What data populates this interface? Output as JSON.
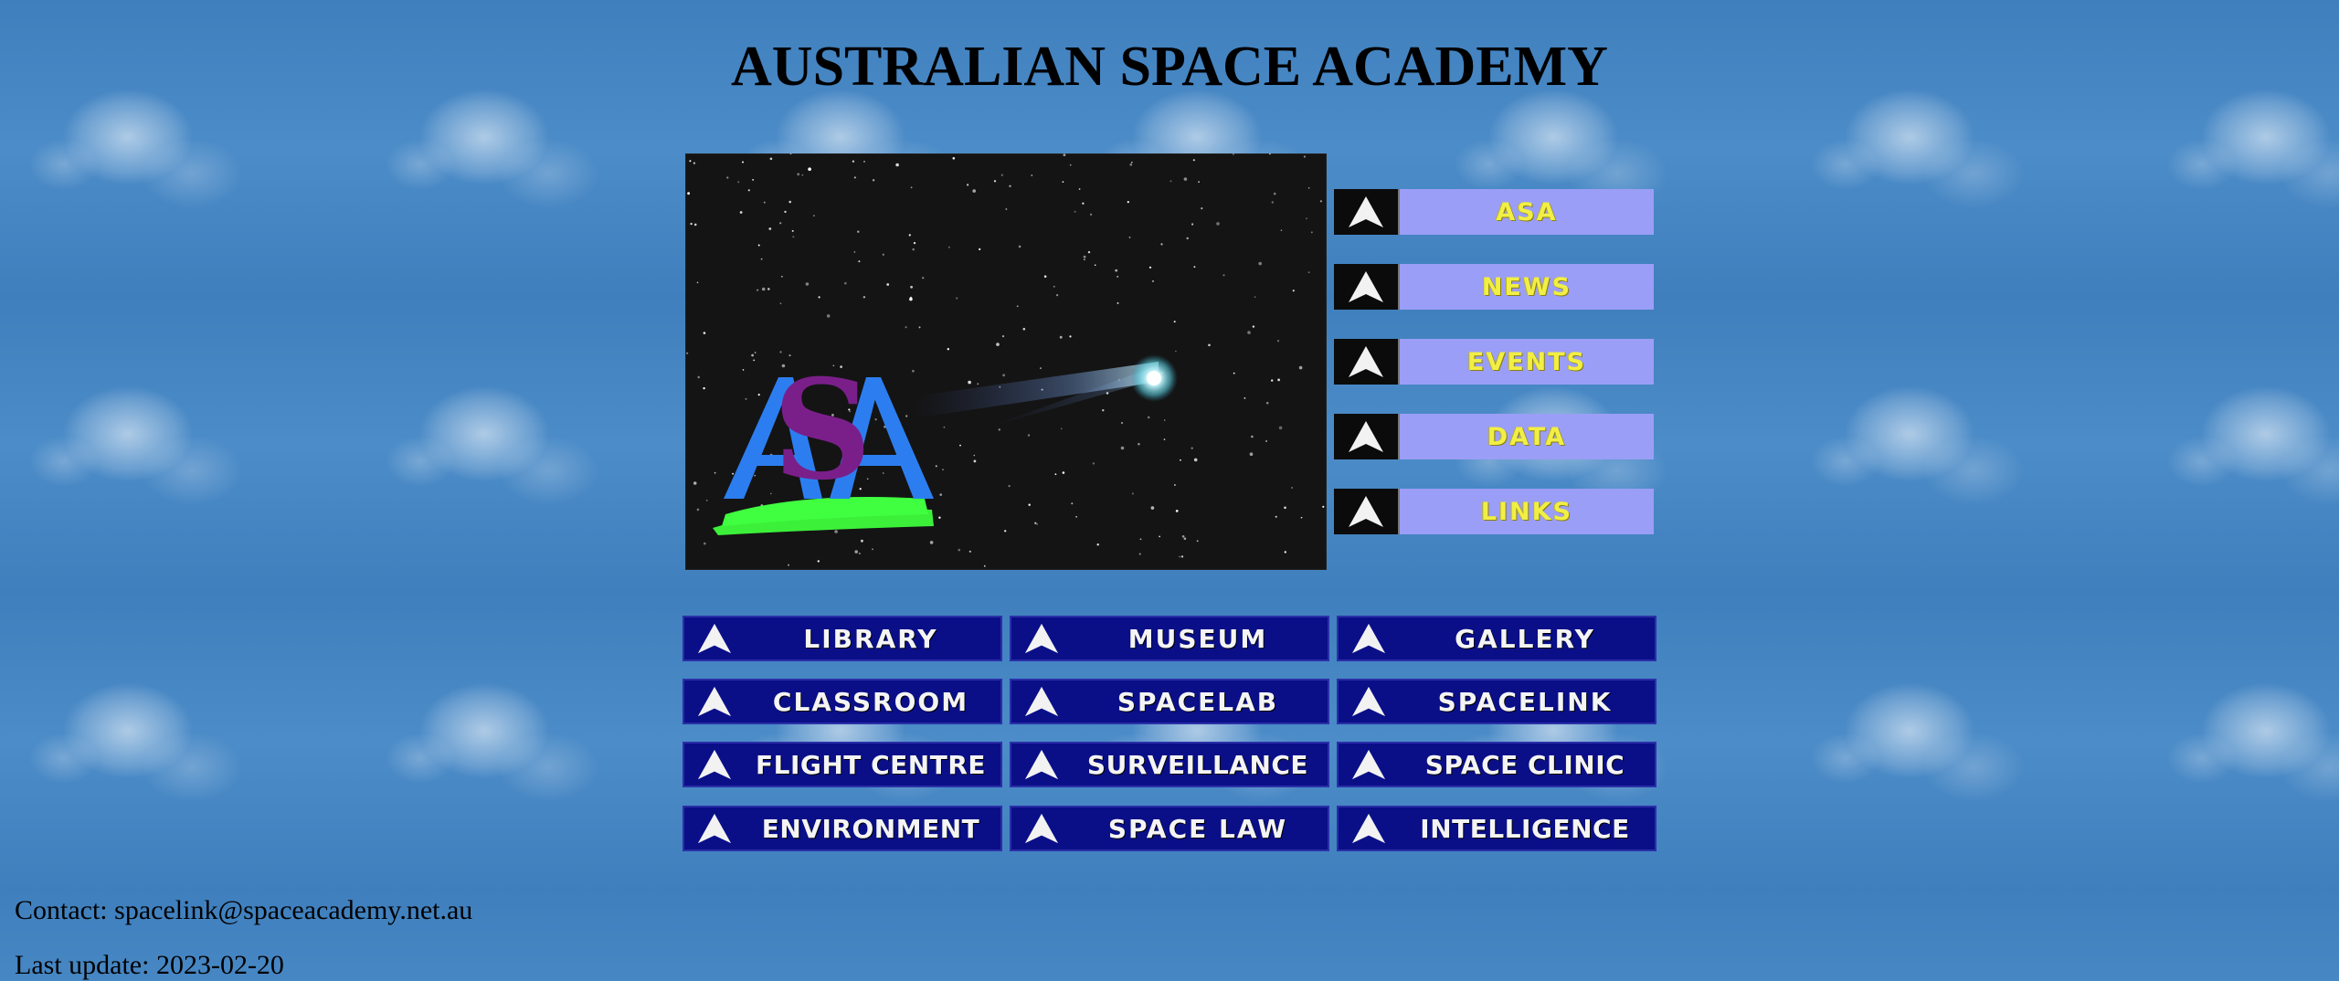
{
  "page": {
    "title": "AUSTRALIAN SPACE ACADEMY"
  },
  "hero_image": {
    "logo_letters": "ASA"
  },
  "side_nav": [
    {
      "label": "ASA",
      "icon": "arrow-up-icon"
    },
    {
      "label": "NEWS",
      "icon": "arrow-up-icon"
    },
    {
      "label": "EVENTS",
      "icon": "arrow-up-icon"
    },
    {
      "label": "DATA",
      "icon": "arrow-up-icon"
    },
    {
      "label": "LINKS",
      "icon": "arrow-up-icon"
    }
  ],
  "grid_nav": [
    {
      "label": "LIBRARY"
    },
    {
      "label": "MUSEUM"
    },
    {
      "label": "GALLERY"
    },
    {
      "label": "CLASSROOM"
    },
    {
      "label": "SPACELAB"
    },
    {
      "label": "SPACELINK"
    },
    {
      "label": "FLIGHT CENTRE"
    },
    {
      "label": "SURVEILLANCE"
    },
    {
      "label": "SPACE CLINIC"
    },
    {
      "label": "ENVIRONMENT"
    },
    {
      "label": "SPACE LAW"
    },
    {
      "label": "INTELLIGENCE"
    }
  ],
  "footer": {
    "contact_label": "Contact: ",
    "contact_email": "spacelink@spaceacademy.net.au",
    "last_update": "Last update: 2023-02-20"
  },
  "colors": {
    "background": "#4a86c0",
    "side_button": "#9b9ef6",
    "side_text": "#f1ef45",
    "grid_button": "#0a0f88",
    "grid_text": "#f4f4f4"
  }
}
